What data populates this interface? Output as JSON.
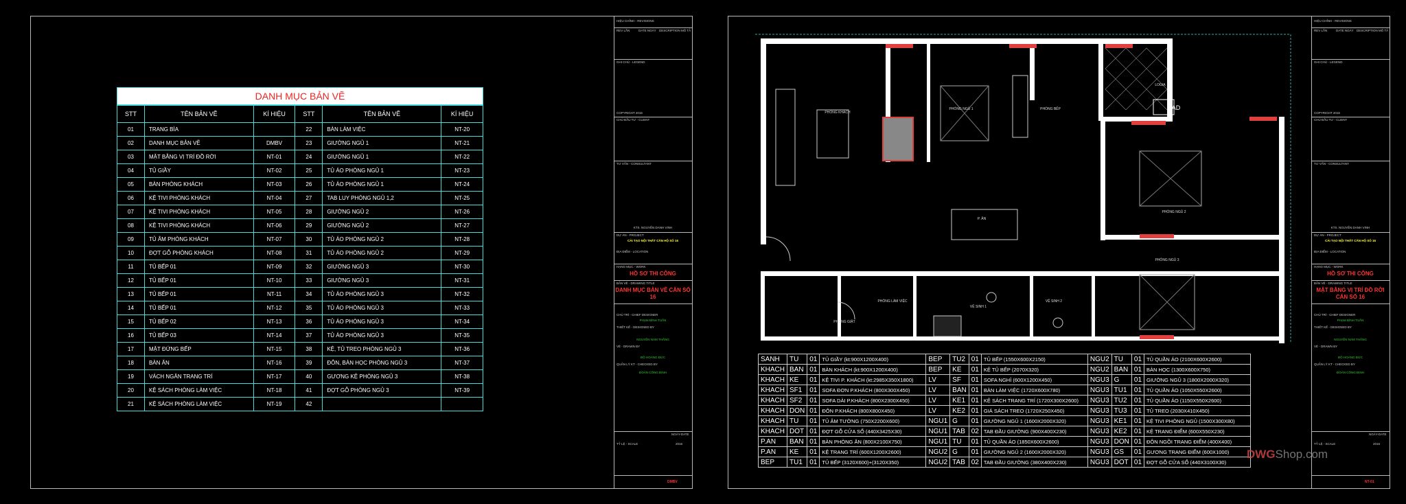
{
  "titleblock": {
    "revisions": "HIỆU CHỈNH - REVISIONS",
    "rev": "REV LẦN",
    "date": "DATE NGÀY",
    "desc": "DESCRIPTION MÔ TẢ",
    "legend": "GHI CHÚ - LEGEND",
    "copyright": "COPYRIGHT 2016",
    "client": "CHỦ ĐẦU TƯ - CLIENT",
    "consultant": "TƯ VẤN - CONSULTANT",
    "director": "KTS. NGUYỄN DANH VINH",
    "project_label": "DỰ ÁN - PROJECT",
    "project_name": "CẢI TẠO NỘI THẤT CĂN HỘ SỐ 16",
    "location_label": "ĐỊA ĐIỂM - LOCATION",
    "work_label": "HẠNG MỤC - WORK",
    "work": "HỒ SƠ THI CÔNG",
    "drawing_label": "BẢN VẼ - DRAWING TITLE",
    "chief": "CHỦ TRÌ - CHIEF DESIGNER",
    "chief_name": "PHẠM ĐÌNH TUẤN",
    "designed": "THIẾT KẾ - DESIGNED BY",
    "designed_name": "NGUYỄN NAM THẮNG",
    "drawn": "VẼ - DRAWN BY",
    "drawn_name": "ĐỖ HOÀNG ĐỨC",
    "checked": "QUẢN LÝ KT - CHECKED BY",
    "checked_name": "ĐOÀN CÔNG ĐỊNH",
    "scale": "TỶ LỆ - SCALE",
    "date_field": "NGÀY-DATE",
    "year": "2016"
  },
  "left_sheet": {
    "drawing_title": "DANH MỤC BẢN VẼ CĂN SỐ 16",
    "sheet_code": "DMBV",
    "table": {
      "title": "DANH MỤC BẢN VẼ",
      "headers": [
        "STT",
        "TÊN BẢN VẼ",
        "KÍ HIỆU",
        "STT",
        "TÊN BẢN VẼ",
        "KÍ HIỆU"
      ],
      "rows": [
        [
          "01",
          "TRANG BÌA",
          "",
          "22",
          "BÀN LÀM VIỆC",
          "NT-20"
        ],
        [
          "02",
          "DANH MỤC BẢN VẼ",
          "DMBV",
          "23",
          "GIƯỜNG NGỦ 1",
          "NT-21"
        ],
        [
          "03",
          "MẶT BẰNG VỊ TRÍ ĐỒ RỜI",
          "NT-01",
          "24",
          "GIƯỜNG NGỦ 1",
          "NT-22"
        ],
        [
          "04",
          "TỦ GIẦY",
          "NT-02",
          "25",
          "TỦ ÁO PHÒNG NGỦ 1",
          "NT-23"
        ],
        [
          "05",
          "BÀN PHÒNG KHÁCH",
          "NT-03",
          "26",
          "TỦ ÁO PHÒNG NGỦ 1",
          "NT-24"
        ],
        [
          "06",
          "KỆ TIVI PHÒNG KHÁCH",
          "NT-04",
          "27",
          "TAB LUY PHÒNG NGỦ 1,2",
          "NT-25"
        ],
        [
          "07",
          "KỆ TIVI PHÒNG KHÁCH",
          "NT-05",
          "28",
          "GIƯỜNG NGỦ 2",
          "NT-26"
        ],
        [
          "08",
          "KỆ TIVI PHÒNG KHÁCH",
          "NT-06",
          "29",
          "GIƯỜNG NGỦ 2",
          "NT-27"
        ],
        [
          "09",
          "TỦ ÂM PHÒNG KHÁCH",
          "NT-07",
          "30",
          "TỦ ÁO PHÒNG NGỦ 2",
          "NT-28"
        ],
        [
          "10",
          "ĐỢT GỖ PHÒNG KHÁCH",
          "NT-08",
          "31",
          "TỦ ÁO PHÒNG NGỦ 2",
          "NT-29"
        ],
        [
          "11",
          "TỦ BẾP 01",
          "NT-09",
          "32",
          "GIƯỜNG NGỦ 3",
          "NT-30"
        ],
        [
          "12",
          "TỦ BẾP 01",
          "NT-10",
          "33",
          "GIƯỜNG NGỦ 3",
          "NT-31"
        ],
        [
          "13",
          "TỦ BẾP 01",
          "NT-11",
          "34",
          "TỦ ÁO PHÒNG NGỦ 3",
          "NT-32"
        ],
        [
          "14",
          "TỦ BẾP 01",
          "NT-12",
          "35",
          "TỦ ÁO PHÒNG NGỦ 3",
          "NT-33"
        ],
        [
          "15",
          "TỦ BẾP 02",
          "NT-13",
          "36",
          "TỦ ÁO PHÒNG NGỦ 3",
          "NT-34"
        ],
        [
          "16",
          "TỦ BẾP 03",
          "NT-14",
          "37",
          "TỦ ÁO PHÒNG NGỦ 3",
          "NT-35"
        ],
        [
          "17",
          "MẶT ĐỨNG BẾP",
          "NT-15",
          "38",
          "KỆ, TỦ TREO PHÒNG NGỦ 3",
          "NT-36"
        ],
        [
          "18",
          "BÀN ĂN",
          "NT-16",
          "39",
          "ĐÔN, BÀN HỌC PHÒNG NGỦ 3",
          "NT-37"
        ],
        [
          "19",
          "VÁCH NGĂN TRANG TRÍ",
          "NT-17",
          "40",
          "GƯƠNG KỆ PHÒNG NGỦ 3",
          "NT-38"
        ],
        [
          "20",
          "KỆ SÁCH PHÒNG LÀM VIỆC",
          "NT-18",
          "41",
          "ĐỢT GỖ PHÒNG NGỦ 3",
          "NT-39"
        ],
        [
          "21",
          "KỆ SÁCH PHÒNG LÀM VIỆC",
          "NT-19",
          "42",
          "",
          ""
        ]
      ]
    }
  },
  "right_sheet": {
    "drawing_title": "MẶT BẰNG VỊ TRÍ ĐỒ RỜI CĂN SỐ 16",
    "sheet_code": "NT-01",
    "rooms": [
      "PHÒNG KHÁCH",
      "P. ĂN",
      "PHÒNG BẾP",
      "PHÒNG NGỦ 1",
      "PHÒNG NGỦ 2",
      "PHÒNG NGỦ 3",
      "PHÒNG LÀM VIỆC",
      "LOGIA",
      "PHÒNG GIẶT",
      "VỆ SINH 1",
      "VỆ SINH 2"
    ],
    "ac_label": "AD",
    "furniture": [
      [
        "SANH",
        "TU",
        "01",
        "TỦ GIẦY (kt:900X1200X400)",
        "BEP",
        "TU2",
        "01",
        "TỦ BẾP (1550X600X2150)",
        "NGU2",
        "TU",
        "01",
        "TỦ QUẦN ÁO (2100X600X2600)"
      ],
      [
        "KHACH",
        "BAN",
        "01",
        "BÀN KHÁCH (kt:900X1200X400)",
        "BEP",
        "KE",
        "01",
        "KỆ TỦ BẾP (2070X320)",
        "NGU2",
        "BAN",
        "01",
        "BÀN HỌC (1300X600X750)"
      ],
      [
        "KHACH",
        "KE",
        "01",
        "KỆ TIVI P. KHÁCH (kt:2985X350X1800)",
        "LV",
        "SF",
        "01",
        "SOFA NGHỈ (600X1200X450)",
        "NGU3",
        "G",
        "01",
        "GIƯỜNG NGỦ 3 (1800X2000X320)"
      ],
      [
        "KHACH",
        "SF1",
        "01",
        "SOFA ĐƠN P.KHÁCH (800X300X450)",
        "LV",
        "BAN",
        "01",
        "BÀN LÀM VIỆC (1720X600X780)",
        "NGU3",
        "TU1",
        "01",
        "TỦ QUẦN ÁO (1050X550X2600)"
      ],
      [
        "KHACH",
        "SF2",
        "01",
        "SOFA DÀI P.KHÁCH (800X2300X450)",
        "LV",
        "KE1",
        "01",
        "KỆ SÁCH TRANG TRÍ (1720X300X2600)",
        "NGU3",
        "TU2",
        "01",
        "TỦ QUẦN ÁO (1150X550X2600)"
      ],
      [
        "KHACH",
        "DON",
        "01",
        "ĐÔN P.KHÁCH (800X800X450)",
        "LV",
        "KE2",
        "01",
        "GIÁ SÁCH TREO (1720X250X450)",
        "NGU3",
        "TU3",
        "01",
        "TỦ TREO (2030X410X450)"
      ],
      [
        "KHACH",
        "TU",
        "01",
        "TỦ ÂM TƯỜNG (750X2200X600)",
        "NGU1",
        "G",
        "01",
        "GIƯỜNG NGỦ 1 (1600X2000X320)",
        "NGU3",
        "KE1",
        "01",
        "KỆ TIVI PHÒNG NGỦ (1500X300X80)"
      ],
      [
        "KHACH",
        "DOT",
        "01",
        "ĐỢT GỖ CỬA SỔ (440X3425X30)",
        "NGU1",
        "TAB",
        "02",
        "TAB ĐẦU GIƯỜNG (900X400X230)",
        "NGU3",
        "KE2",
        "01",
        "KỆ TRANG ĐIỂM (600X550X230)"
      ],
      [
        "P.AN",
        "BAN",
        "01",
        "BÀN PHÒNG ĂN (800X2100X750)",
        "NGU1",
        "TU",
        "01",
        "TỦ QUẦN ÁO (1850X600X2600)",
        "NGU3",
        "DON",
        "01",
        "ĐÔN NGỒI TRANG ĐIỂM (400X400)"
      ],
      [
        "P.AN",
        "KE",
        "01",
        "KỆ TRANG TRÍ (600X1200X2600)",
        "NGU2",
        "G",
        "01",
        "GIƯỜNG NGỦ 2 (1600X2000X320)",
        "NGU3",
        "GS",
        "01",
        "GƯƠNG TRANG ĐIỂM (600X1000)"
      ],
      [
        "BEP",
        "TU1",
        "01",
        "TỦ BẾP (3120X600)+(3120X350)",
        "NGU2",
        "TAB",
        "02",
        "TAB ĐẦU GIƯỜNG (380X400X230)",
        "NGU3",
        "DOT",
        "01",
        "ĐỢT GỖ CỬA SỔ (440X3100X30)"
      ]
    ],
    "watermark": {
      "a": "DWG",
      "b": "Shop.com"
    }
  }
}
